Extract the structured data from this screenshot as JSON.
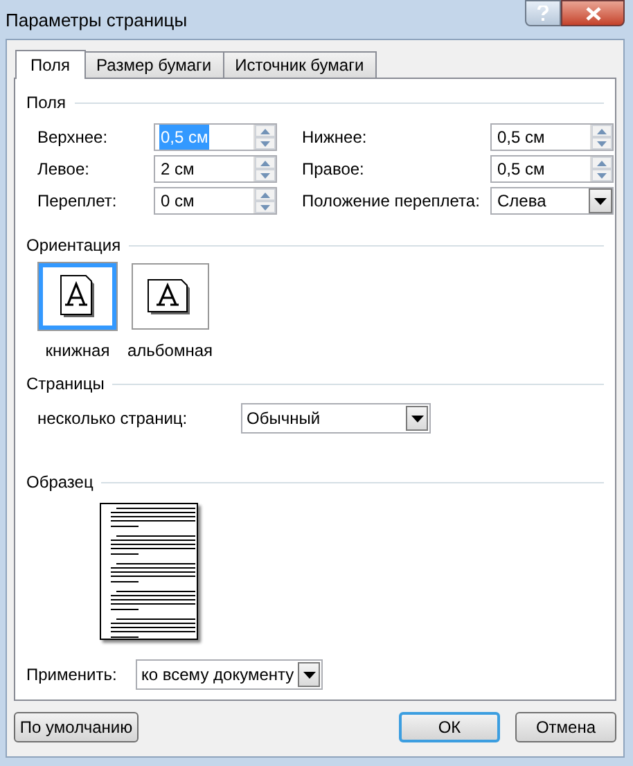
{
  "window": {
    "title": "Параметры страницы"
  },
  "tabs": [
    {
      "label": "Поля",
      "selected": true
    },
    {
      "label": "Размер бумаги",
      "selected": false
    },
    {
      "label": "Источник бумаги",
      "selected": false
    }
  ],
  "margins": {
    "title": "Поля",
    "fields": [
      {
        "label": "Верхнее:",
        "value": "0,5 см",
        "kind": "spinner",
        "selected": true
      },
      {
        "label": "Нижнее:",
        "value": "0,5 см",
        "kind": "spinner",
        "selected": false
      },
      {
        "label": "Левое:",
        "value": "2 см",
        "kind": "spinner",
        "selected": false
      },
      {
        "label": "Правое:",
        "value": "0,5 см",
        "kind": "spinner",
        "selected": false
      },
      {
        "label": "Переплет:",
        "value": "0 см",
        "kind": "spinner",
        "selected": false
      },
      {
        "label": "Положение переплета:",
        "value": "Слева",
        "kind": "dropdown",
        "selected": false
      }
    ]
  },
  "orientation": {
    "title": "Ориентация",
    "options": [
      {
        "label": "книжная",
        "kind": "portrait",
        "selected": true
      },
      {
        "label": "альбомная",
        "kind": "landscape",
        "selected": false
      }
    ]
  },
  "pages": {
    "title": "Страницы",
    "label": "несколько страниц:",
    "value": "Обычный"
  },
  "preview": {
    "title": "Образец"
  },
  "apply": {
    "label": "Применить:",
    "value": "ко всему документу"
  },
  "buttons": [
    {
      "label": "По умолчанию",
      "default": false
    },
    {
      "label": "ОК",
      "default": true
    },
    {
      "label": "Отмена",
      "default": false
    }
  ]
}
